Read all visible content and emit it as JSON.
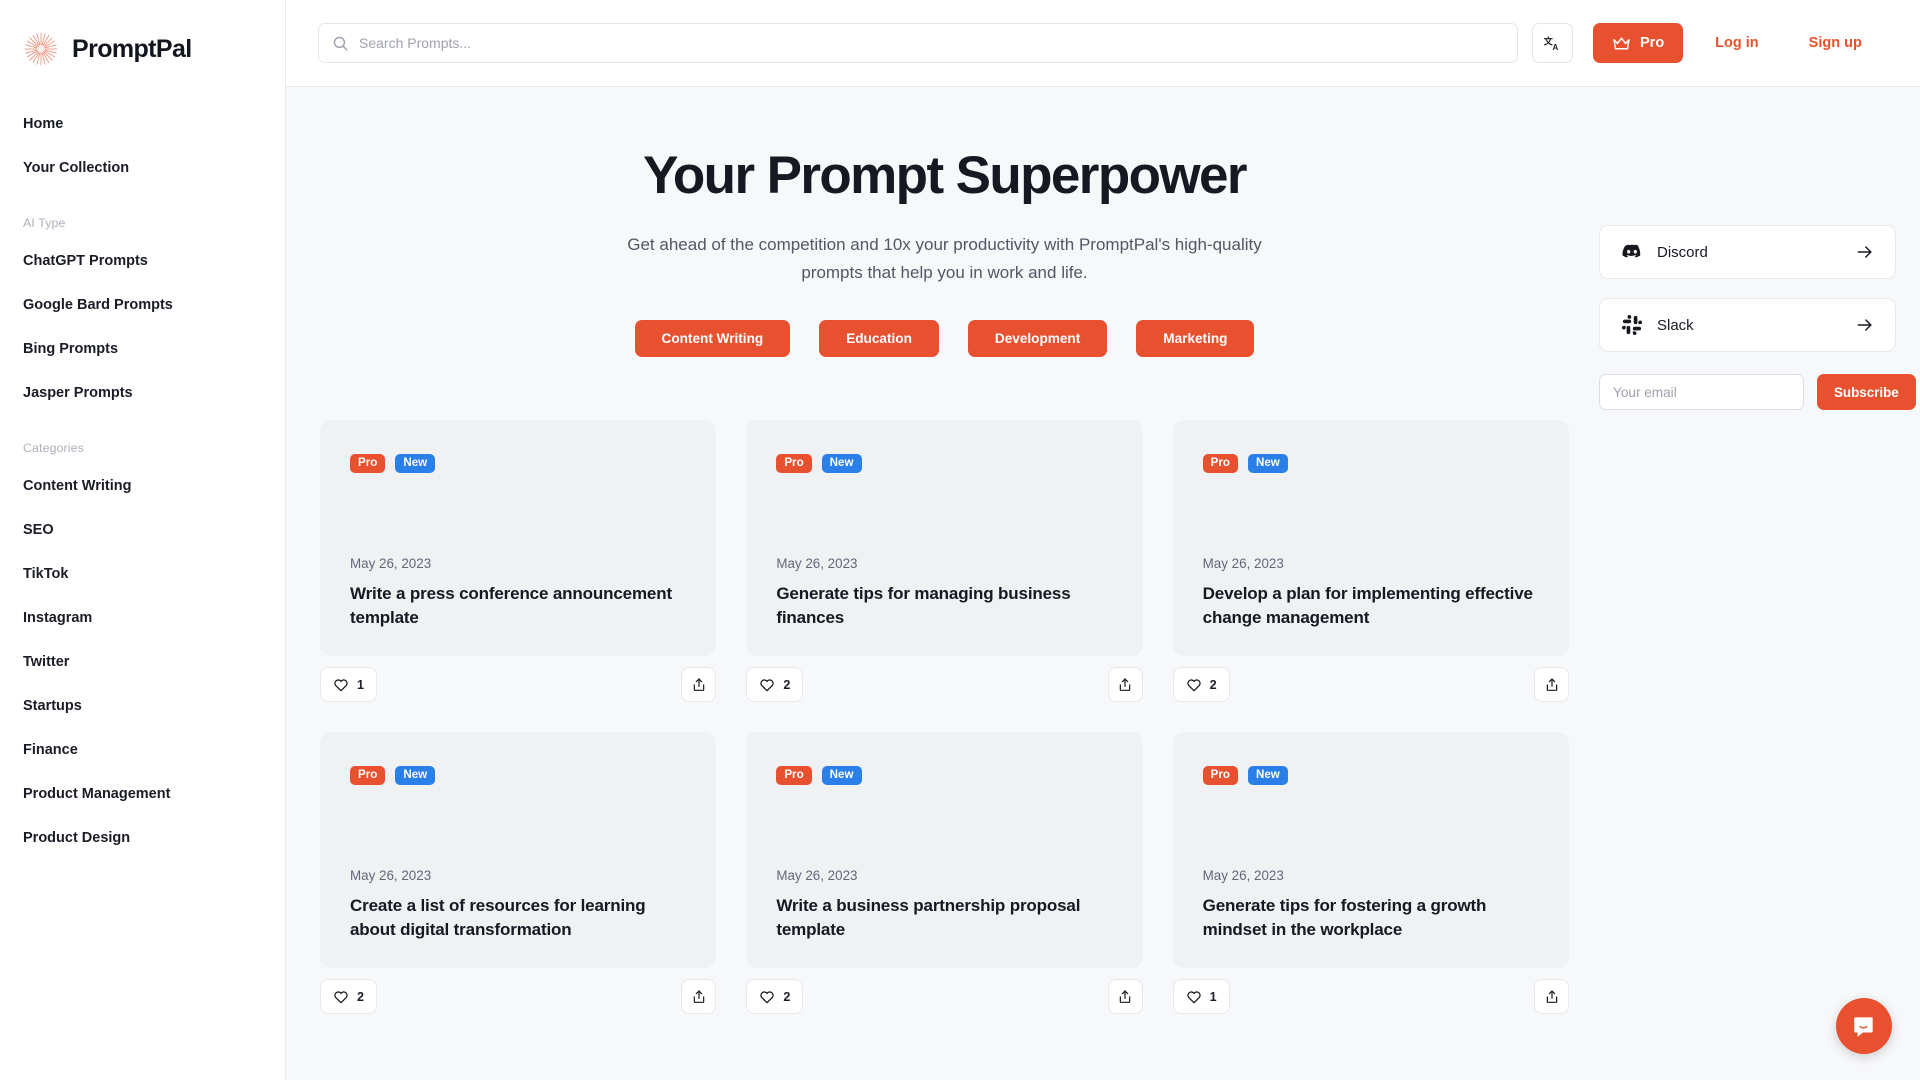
{
  "brand": {
    "name": "PromptPal",
    "logo_icon": "sunburst-logo-icon",
    "accent": "#e8512f"
  },
  "sidebar": {
    "primary": [
      {
        "label": "Home"
      },
      {
        "label": "Your Collection"
      }
    ],
    "groups": [
      {
        "label": "AI Type",
        "items": [
          {
            "label": "ChatGPT Prompts"
          },
          {
            "label": "Google Bard Prompts"
          },
          {
            "label": "Bing Prompts"
          },
          {
            "label": "Jasper Prompts"
          }
        ]
      },
      {
        "label": "Categories",
        "items": [
          {
            "label": "Content Writing"
          },
          {
            "label": "SEO"
          },
          {
            "label": "TikTok"
          },
          {
            "label": "Instagram"
          },
          {
            "label": "Twitter"
          },
          {
            "label": "Startups"
          },
          {
            "label": "Finance"
          },
          {
            "label": "Product Management"
          },
          {
            "label": "Product Design"
          }
        ]
      }
    ]
  },
  "topbar": {
    "search_placeholder": "Search Prompts...",
    "search_value": "",
    "search_icon": "search-icon",
    "language_icon": "translate-icon",
    "pro_label": "Pro",
    "pro_icon": "crown-icon",
    "login_label": "Log in",
    "signup_label": "Sign up"
  },
  "hero": {
    "title": "Your Prompt Superpower",
    "subtitle": "Get ahead of the competition and 10x your productivity with PromptPal's high-quality prompts that help you in work and life.",
    "category_buttons": [
      {
        "label": "Content Writing"
      },
      {
        "label": "Education"
      },
      {
        "label": "Development"
      },
      {
        "label": "Marketing"
      }
    ]
  },
  "cards": [
    {
      "badges": [
        "Pro",
        "New"
      ],
      "date": "May 26, 2023",
      "title": "Write a press conference announcement template",
      "likes": "1",
      "like_icon": "heart-icon",
      "share_icon": "share-icon"
    },
    {
      "badges": [
        "Pro",
        "New"
      ],
      "date": "May 26, 2023",
      "title": "Generate tips for managing business finances",
      "likes": "2",
      "like_icon": "heart-icon",
      "share_icon": "share-icon"
    },
    {
      "badges": [
        "Pro",
        "New"
      ],
      "date": "May 26, 2023",
      "title": "Develop a plan for implementing effective change management",
      "likes": "2",
      "like_icon": "heart-icon",
      "share_icon": "share-icon"
    },
    {
      "badges": [
        "Pro",
        "New"
      ],
      "date": "May 26, 2023",
      "title": "Create a list of resources for learning about digital transformation",
      "likes": "2",
      "like_icon": "heart-icon",
      "share_icon": "share-icon"
    },
    {
      "badges": [
        "Pro",
        "New"
      ],
      "date": "May 26, 2023",
      "title": "Write a business partnership proposal template",
      "likes": "2",
      "like_icon": "heart-icon",
      "share_icon": "share-icon"
    },
    {
      "badges": [
        "Pro",
        "New"
      ],
      "date": "May 26, 2023",
      "title": "Generate tips for fostering a growth mindset in the workplace",
      "likes": "1",
      "like_icon": "heart-icon",
      "share_icon": "share-icon"
    }
  ],
  "right_rail": {
    "social": [
      {
        "name": "Discord",
        "icon": "discord-icon",
        "arrow": "arrow-right-icon"
      },
      {
        "name": "Slack",
        "icon": "slack-icon",
        "arrow": "arrow-right-icon"
      }
    ],
    "email_placeholder": "Your email",
    "email_value": "",
    "subscribe_label": "Subscribe"
  },
  "chat": {
    "icon": "chat-bubble-icon"
  },
  "badge_colors": {
    "pro": "#e8512f",
    "new": "#2b7fe8"
  }
}
